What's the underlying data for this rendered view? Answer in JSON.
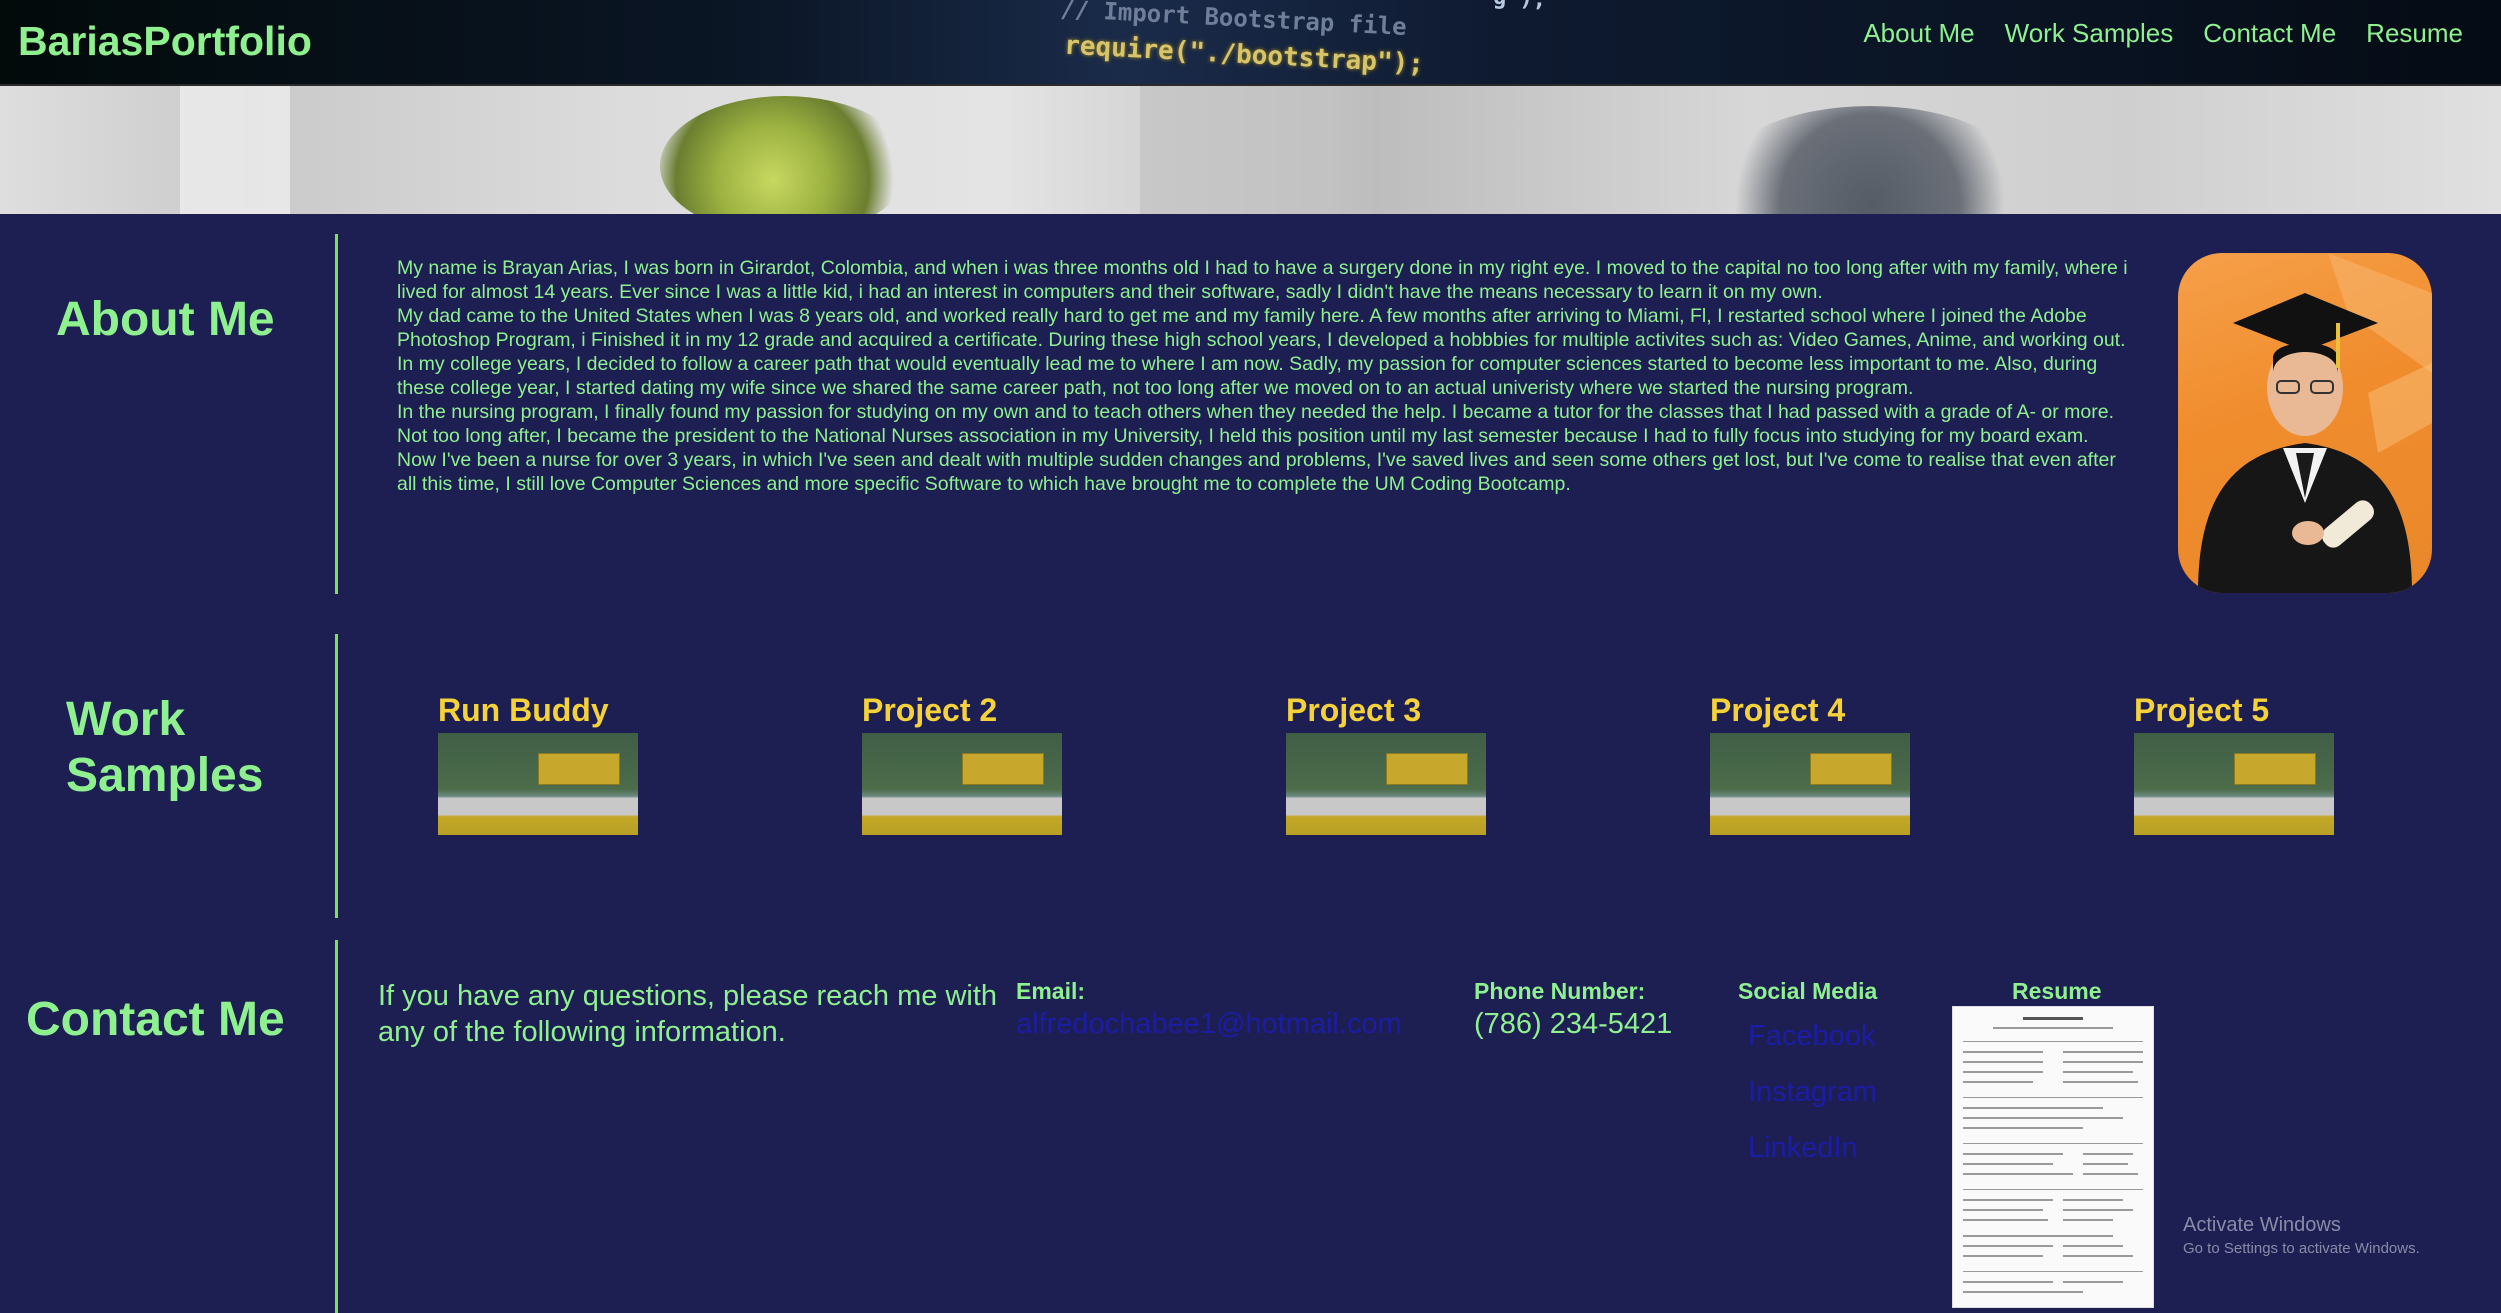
{
  "header": {
    "brand": "BariasPortfolio",
    "nav": [
      "About Me",
      "Work Samples",
      "Contact Me",
      "Resume"
    ],
    "code_lines": [
      "// Import Bootstrap file",
      "require(\"./bootstrap\");",
      "\"g\");"
    ]
  },
  "about": {
    "title": "About Me",
    "paragraphs": [
      "My name is Brayan Arias, I was born in Girardot, Colombia, and when i was three months old I had to have a surgery done in my right eye. I moved to the capital no too long after with my family, where i lived for almost 14 years. Ever since I was a little kid, i had an interest in computers and their software, sadly I didn't have the means necessary to learn it on my own.",
      "My dad came to the United States when I was 8 years old, and worked really hard to get me and my family here. A few months after arriving to Miami, Fl, I restarted school where I joined the Adobe Photoshop Program, i Finished it in my 12 grade and acquired a certificate. During these high school years, I developed a hobbbies for multiple activites such as: Video Games, Anime, and working out.",
      "In my college years, I decided to follow a career path that would eventually lead me to where I am now. Sadly, my passion for computer sciences started to become less important to me. Also, during these college year, I started dating my wife since we shared the same career path, not too long after we moved on to an actual univeristy where we started the nursing program.",
      "In the nursing program, I finally found my passion for studying on my own and to teach others when they needed the help. I became a tutor for the classes that I had passed with a grade of A- or more. Not too long after, I became the president to the National Nurses association in my University, I held this position until my last semester because I had to fully focus into studying for my board exam.",
      "Now I've been a nurse for over 3 years, in which I've seen and dealt with multiple sudden changes and problems, I've saved lives and seen some others get lost, but I've come to realise that even after all this time, I still love Computer Sciences and more specific Software to which have brought me to complete the UM Coding Bootcamp."
    ]
  },
  "work": {
    "title_line1": "Work",
    "title_line2": "Samples",
    "projects": [
      "Run Buddy",
      "Project 2",
      "Project 3",
      "Project 4",
      "Project 5"
    ]
  },
  "contact": {
    "title": "Contact Me",
    "message": "If you have any questions, please reach me with any of the following information.",
    "email_label": "Email:",
    "email": "alfredochabee1@hotmail.com",
    "phone_label": "Phone Number:",
    "phone": "(786) 234-5421",
    "social_label": "Social Media",
    "social": [
      "Facebook",
      "Instagram",
      "LinkedIn"
    ],
    "resume_label": "Resume"
  },
  "watermark": {
    "line1": "Activate Windows",
    "line2": "Go to Settings to activate Windows."
  },
  "colors": {
    "background": "#1d1f52",
    "accent_green": "#8ff08f",
    "project_yellow": "#f5d23a",
    "link_blue": "#1c1ca6",
    "divider_green": "#7ee05a"
  }
}
